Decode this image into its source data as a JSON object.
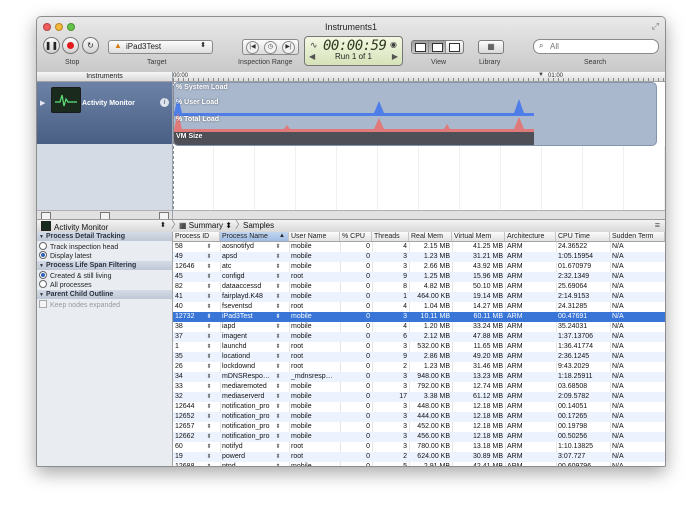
{
  "window": {
    "title": "Instruments1"
  },
  "toolbar": {
    "stop_label": "Stop",
    "target_label": "Target",
    "target_value": "iPad3Test",
    "inspection_label": "Inspection Range",
    "timer": "00:00:59",
    "run_label": "Run 1 of 1",
    "view_label": "View",
    "library_label": "Library",
    "search_label": "Search",
    "search_placeholder": "All"
  },
  "instruments_header": "Instruments",
  "instrument": {
    "name": "Activity Monitor"
  },
  "timeline": {
    "start_tick": "00:00",
    "end_tick": "01:00",
    "tracks": [
      "% System Load",
      "% User Load",
      "% Total Load",
      "VM Size"
    ]
  },
  "colors": {
    "system_load": "#5b6fd6",
    "user_load": "#4f7ee8",
    "total_load": "#e07a7a",
    "vm_size": "#4f4f57",
    "selection": "#3875d7"
  },
  "nav": {
    "instrument": "Activity Monitor",
    "summary": "Summary",
    "samples": "Samples"
  },
  "detail": {
    "section1": "Process Detail Tracking",
    "opt_track": "Track inspection head",
    "opt_display": "Display latest",
    "section2": "Process Life Span Filtering",
    "opt_created": "Created & still living",
    "opt_all": "All processes",
    "section3": "Parent Child Outline",
    "opt_keep": "Keep nodes expanded"
  },
  "table": {
    "columns": [
      "Process ID",
      "Process Name",
      "User Name",
      "% CPU",
      "Threads",
      "Real Mem",
      "Virtual Mem",
      "Architecture",
      "CPU Time",
      "Sudden Term"
    ],
    "rows": [
      [
        "58",
        "aosnotifyd",
        "mobile",
        "0",
        "4",
        "2.15 MB",
        "41.25 MB",
        "ARM",
        "24.36522",
        "N/A"
      ],
      [
        "49",
        "apsd",
        "mobile",
        "0",
        "3",
        "1.23 MB",
        "31.21 MB",
        "ARM",
        "1:05.15954",
        "N/A"
      ],
      [
        "12646",
        "atc",
        "mobile",
        "0",
        "3",
        "2.66 MB",
        "43.92 MB",
        "ARM",
        "01.670979",
        "N/A"
      ],
      [
        "45",
        "configd",
        "root",
        "0",
        "9",
        "1.25 MB",
        "15.96 MB",
        "ARM",
        "2:32.1349",
        "N/A"
      ],
      [
        "82",
        "dataaccessd",
        "mobile",
        "0",
        "8",
        "4.82 MB",
        "50.10 MB",
        "ARM",
        "25.69064",
        "N/A"
      ],
      [
        "41",
        "fairplayd.K48",
        "mobile",
        "0",
        "1",
        "464.00 KB",
        "19.14 MB",
        "ARM",
        "2:14.9153",
        "N/A"
      ],
      [
        "40",
        "fseventsd",
        "root",
        "0",
        "4",
        "1.04 MB",
        "14.27 MB",
        "ARM",
        "24.31285",
        "N/A"
      ],
      [
        "12732",
        "iPad3Test",
        "mobile",
        "0",
        "3",
        "10.11 MB",
        "60.11 MB",
        "ARM",
        "00.47691",
        "N/A"
      ],
      [
        "38",
        "iapd",
        "mobile",
        "0",
        "4",
        "1.20 MB",
        "33.24 MB",
        "ARM",
        "35.24031",
        "N/A"
      ],
      [
        "37",
        "imagent",
        "mobile",
        "0",
        "6",
        "2.12 MB",
        "47.88 MB",
        "ARM",
        "1:37.13706",
        "N/A"
      ],
      [
        "1",
        "launchd",
        "root",
        "0",
        "3",
        "532.00 KB",
        "11.65 MB",
        "ARM",
        "1:36.41774",
        "N/A"
      ],
      [
        "35",
        "locationd",
        "root",
        "0",
        "9",
        "2.86 MB",
        "49.20 MB",
        "ARM",
        "2:36.1245",
        "N/A"
      ],
      [
        "26",
        "lockdownd",
        "root",
        "0",
        "2",
        "1.23 MB",
        "31.46 MB",
        "ARM",
        "9:43.2029",
        "N/A"
      ],
      [
        "34",
        "mDNSRespo…",
        "_mdnsresp…",
        "0",
        "3",
        "948.00 KB",
        "13.23 MB",
        "ARM",
        "1:18.25911",
        "N/A"
      ],
      [
        "33",
        "mediaremoted",
        "mobile",
        "0",
        "3",
        "792.00 KB",
        "12.74 MB",
        "ARM",
        "03.68508",
        "N/A"
      ],
      [
        "32",
        "mediaserverd",
        "mobile",
        "0",
        "17",
        "3.38 MB",
        "61.12 MB",
        "ARM",
        "2:09.5782",
        "N/A"
      ],
      [
        "12644",
        "notification_pro",
        "mobile",
        "0",
        "3",
        "448.00 KB",
        "12.18 MB",
        "ARM",
        "00.14051",
        "N/A"
      ],
      [
        "12652",
        "notification_pro",
        "mobile",
        "0",
        "3",
        "444.00 KB",
        "12.18 MB",
        "ARM",
        "00.17265",
        "N/A"
      ],
      [
        "12657",
        "notification_pro",
        "mobile",
        "0",
        "3",
        "452.00 KB",
        "12.18 MB",
        "ARM",
        "00.19798",
        "N/A"
      ],
      [
        "12662",
        "notification_pro",
        "mobile",
        "0",
        "3",
        "456.00 KB",
        "12.18 MB",
        "ARM",
        "00.50256",
        "N/A"
      ],
      [
        "60",
        "notifyd",
        "root",
        "0",
        "3",
        "780.00 KB",
        "13.18 MB",
        "ARM",
        "1:10.13825",
        "N/A"
      ],
      [
        "19",
        "powerd",
        "root",
        "0",
        "2",
        "624.00 KB",
        "30.89 MB",
        "ARM",
        "3:07.727",
        "N/A"
      ],
      [
        "12688",
        "ptpd",
        "mobile",
        "0",
        "5",
        "2.91 MB",
        "42.41 MB",
        "ARM",
        "00.609796",
        "N/A"
      ]
    ],
    "selected_index": 7,
    "sorted_column": 1
  }
}
